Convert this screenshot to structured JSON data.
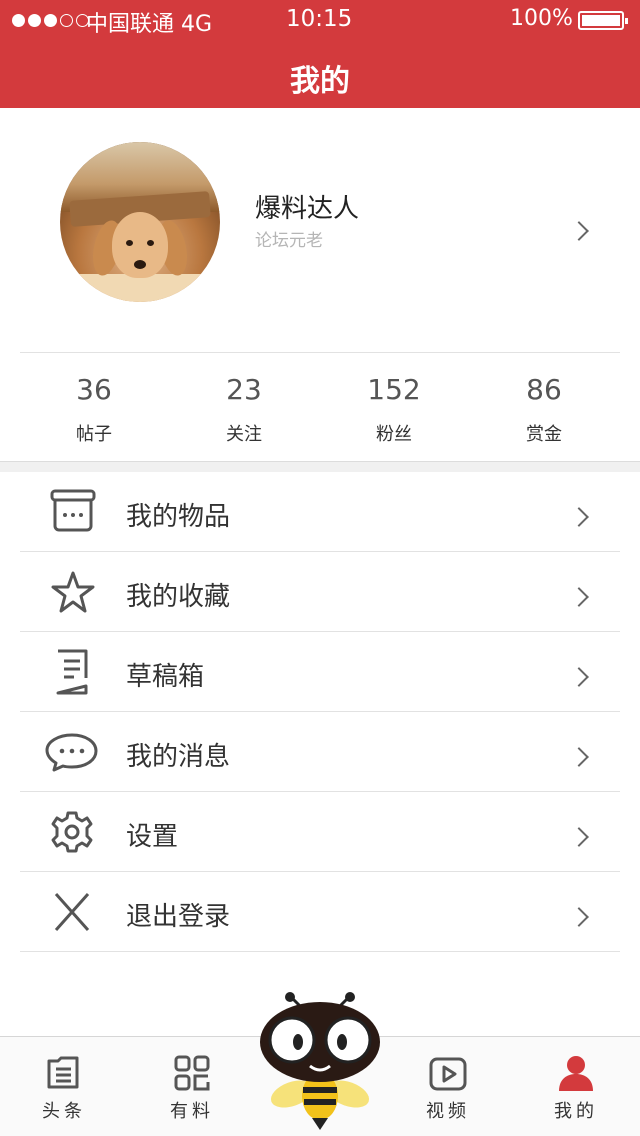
{
  "status_bar": {
    "carrier": "中国联通  4G",
    "time": "10:15",
    "battery": "100%"
  },
  "nav": {
    "title": "我的"
  },
  "profile": {
    "name": "爆料达人",
    "subtitle": "论坛元老"
  },
  "stats": [
    {
      "value": "36",
      "label": "帖子"
    },
    {
      "value": "23",
      "label": "关注"
    },
    {
      "value": "152",
      "label": "粉丝"
    },
    {
      "value": "86",
      "label": "赏金"
    }
  ],
  "menu": [
    {
      "label": "我的物品",
      "icon": "box-icon"
    },
    {
      "label": "我的收藏",
      "icon": "star-icon"
    },
    {
      "label": "草稿箱",
      "icon": "draft-icon"
    },
    {
      "label": "我的消息",
      "icon": "chat-icon"
    },
    {
      "label": "设置",
      "icon": "gear-icon"
    },
    {
      "label": "退出登录",
      "icon": "close-icon"
    }
  ],
  "tabs": [
    {
      "label": "头条",
      "icon": "news-icon"
    },
    {
      "label": "有料",
      "icon": "grid-icon"
    },
    {
      "label": "视频",
      "icon": "video-icon"
    },
    {
      "label": "我的",
      "icon": "user-icon",
      "active": true
    }
  ],
  "colors": {
    "brand": "#d33a3d",
    "text": "#333333",
    "muted": "#b5b5b5"
  }
}
